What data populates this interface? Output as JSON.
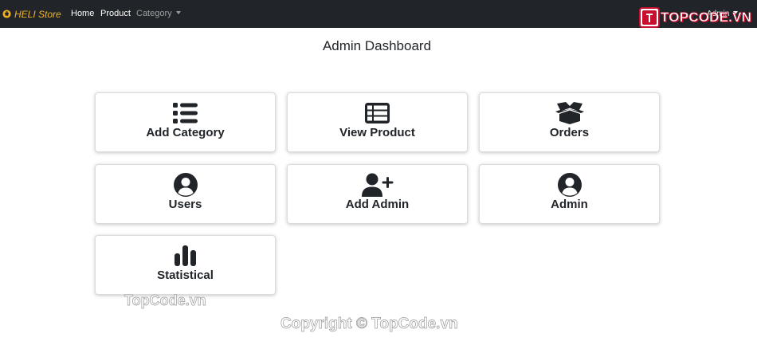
{
  "navbar": {
    "brand": "HELI Store",
    "links": {
      "home": "Home",
      "product": "Product",
      "category": "Category"
    },
    "admin_menu": "Admin"
  },
  "logo": {
    "text": "TOPCODE.VN",
    "badge_icon": "topcode-logo-badge"
  },
  "page": {
    "title": "Admin Dashboard"
  },
  "cards": {
    "add_category": {
      "label": "Add Category",
      "icon": "list-icon"
    },
    "view_product": {
      "label": "View Product",
      "icon": "table-icon"
    },
    "orders": {
      "label": "Orders",
      "icon": "box-open-icon"
    },
    "users": {
      "label": "Users",
      "icon": "user-circle-icon"
    },
    "add_admin": {
      "label": "Add Admin",
      "icon": "user-plus-icon"
    },
    "admin": {
      "label": "Admin",
      "icon": "user-circle-icon"
    },
    "statistical": {
      "label": "Statistical",
      "icon": "chart-bar-icon"
    }
  },
  "watermarks": {
    "topcode": "TopCode.vn",
    "copyright": "Copyright © TopCode.vn"
  },
  "colors": {
    "navbar_bg": "#212529",
    "brand": "#f0b323",
    "logo_accent": "#c8102e",
    "icon": "#212529"
  }
}
